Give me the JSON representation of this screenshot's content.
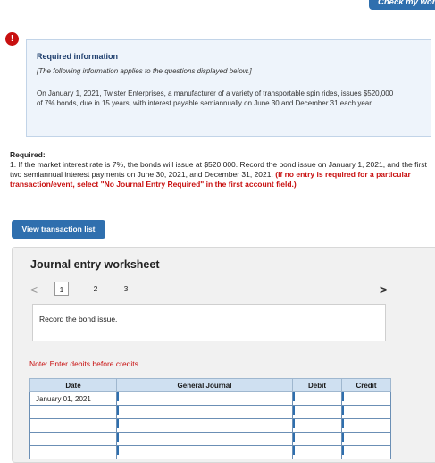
{
  "header": {
    "check_button": "Check my work"
  },
  "info": {
    "alert_icon": "!",
    "title": "Required information",
    "note": "[The following information applies to the questions displayed below.]",
    "body": "On January 1, 2021, Twister Enterprises, a manufacturer of a variety of transportable spin rides, issues $520,000 of 7% bonds, due in 15 years, with interest payable semiannually on June 30 and December 31 each year."
  },
  "required": {
    "label": "Required:",
    "text": "1. If the market interest rate is 7%, the bonds will issue at $520,000. Record the bond issue on January 1, 2021, and the first two semiannual interest payments on June 30, 2021, and December 31, 2021.",
    "instruction": "(If no entry is required for a particular transaction/event, select \"No Journal Entry Required\" in the first account field.)"
  },
  "view_button": "View transaction list",
  "worksheet": {
    "title": "Journal entry worksheet",
    "prev_icon": "<",
    "next_icon": ">",
    "pages": [
      "1",
      "2",
      "3"
    ],
    "active_page": "1",
    "instruction": "Record the bond issue.",
    "note": "Note: Enter debits before credits.",
    "table": {
      "headers": [
        "Date",
        "General Journal",
        "Debit",
        "Credit"
      ],
      "rows": [
        [
          "January 01, 2021",
          "",
          "",
          ""
        ],
        [
          "",
          "",
          "",
          ""
        ],
        [
          "",
          "",
          "",
          ""
        ],
        [
          "",
          "",
          "",
          ""
        ],
        [
          "",
          "",
          "",
          ""
        ]
      ]
    }
  },
  "colors": {
    "accent": "#2f6fae",
    "alert": "#c81010",
    "info_bg": "#eef4fb",
    "table_header": "#cfe0f1"
  }
}
